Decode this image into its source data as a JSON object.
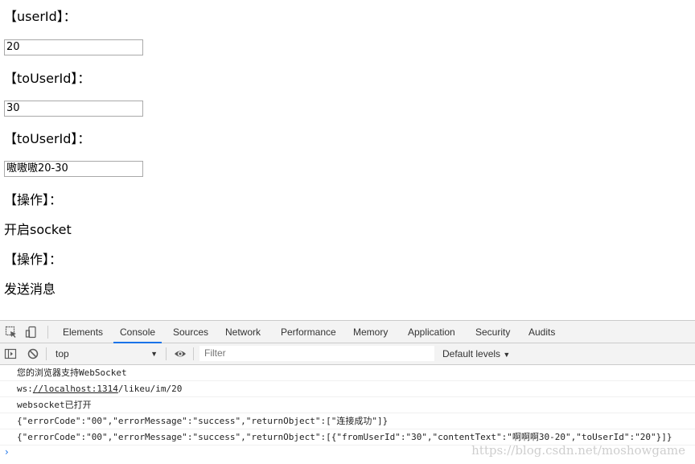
{
  "form": {
    "label_userid": "【userId】：",
    "userid_value": "20",
    "label_touserid": "【toUserId】：",
    "touserid_value": "30",
    "label_touserid_2": "【toUserId】：",
    "content_value": "嗷嗷嗷20-30",
    "label_action_1": "【操作】：",
    "open_socket": "开启socket",
    "label_action_2": "【操作】：",
    "send_message": "发送消息"
  },
  "devtools": {
    "tabs": [
      "Elements",
      "Console",
      "Sources",
      "Network",
      "Performance",
      "Memory",
      "Application",
      "Security",
      "Audits"
    ],
    "active_tab": "Console",
    "context": "top",
    "filter_placeholder": "Filter",
    "levels": "Default levels",
    "icons": [
      "inspect-icon",
      "device-toggle-icon",
      "sidebar-toggle-icon",
      "clear-console-icon",
      "eye-icon",
      "dropdown-arrow-icon",
      "prompt-chevron-icon"
    ],
    "accent": "#1a73e8"
  },
  "console": {
    "line1": "您的浏览器支持WebSocket",
    "line2_prefix": "ws:",
    "line2_link": "//localhost:1314",
    "line2_suffix": "/likeu/im/20",
    "line3": "websocket已打开",
    "line4": "{\"errorCode\":\"00\",\"errorMessage\":\"success\",\"returnObject\":[\"连接成功\"]}",
    "line5": "{\"errorCode\":\"00\",\"errorMessage\":\"success\",\"returnObject\":[{\"fromUserId\":\"30\",\"contentText\":\"啊啊啊30-20\",\"toUserId\":\"20\"}]}",
    "prompt": "›"
  },
  "watermark": "https://blog.csdn.net/moshowgame"
}
